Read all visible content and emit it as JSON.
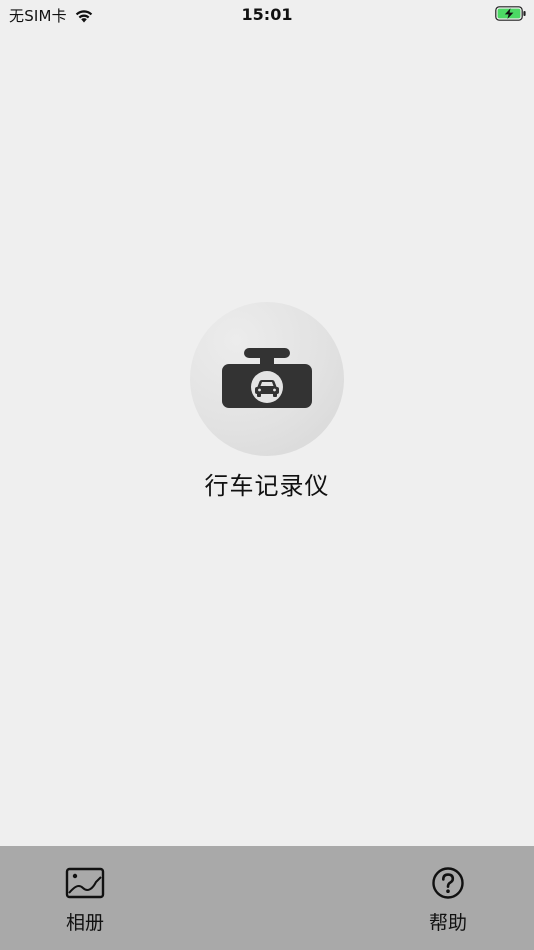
{
  "status_bar": {
    "carrier": "无SIM卡",
    "time": "15:01",
    "wifi_icon": "wifi-icon",
    "battery_icon": "battery-charging-icon",
    "battery_color": "#4cd964"
  },
  "main": {
    "device_icon": "dashcam-car-icon",
    "device_label": "行车记录仪"
  },
  "tab_bar": {
    "background": "#a9a9a9",
    "tabs": [
      {
        "label": "相册",
        "icon": "photo-album-icon"
      },
      {
        "label": "帮助",
        "icon": "help-circle-icon"
      }
    ]
  }
}
